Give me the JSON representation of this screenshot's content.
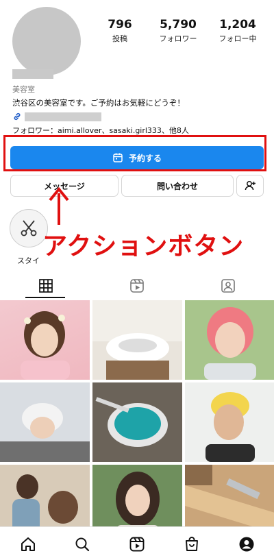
{
  "profile": {
    "stats": [
      {
        "value": "796",
        "label": "投稿"
      },
      {
        "value": "5,790",
        "label": "フォロワー"
      },
      {
        "value": "1,204",
        "label": "フォロー中"
      }
    ],
    "category": "美容室",
    "bio": "渋谷区の美容室です。ご予約はお気軽にどうぞ！",
    "followers_line": "フォロワー：aimi.allover、sasaki.girl333、他8人"
  },
  "actions": {
    "primary_label": "予約する",
    "message_label": "メッセージ",
    "inquiry_label": "問い合わせ"
  },
  "annotation": {
    "caption": "アクションボタン",
    "color": "#e01010"
  },
  "highlights": [
    {
      "label": "スタイ",
      "icon": "scissors-icon"
    }
  ],
  "tabs": [
    {
      "name": "grid",
      "icon": "grid-icon",
      "active": true
    },
    {
      "name": "reels",
      "icon": "reels-icon",
      "active": false
    },
    {
      "name": "tagged",
      "icon": "tagged-person-icon",
      "active": false
    }
  ],
  "bottom_nav": [
    "home-icon",
    "search-icon",
    "reels-icon",
    "shop-icon",
    "profile-icon"
  ],
  "colors": {
    "accent_blue": "#1a87ee",
    "annotation_red": "#e01010",
    "placeholder_gray": "#c7c7c7"
  }
}
